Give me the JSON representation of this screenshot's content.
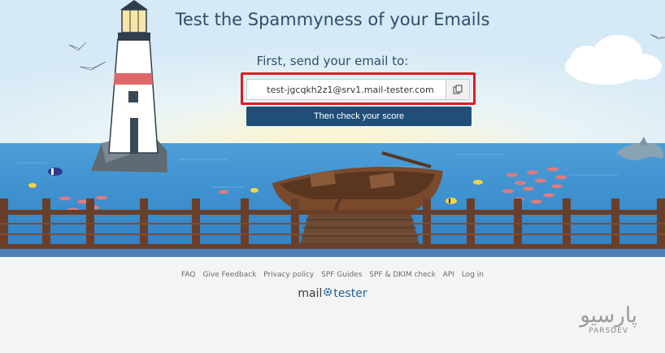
{
  "hero": {
    "title": "Test the Spammyness of your Emails",
    "subtitle": "First, send your email to:",
    "email_address": "test-jgcqkh2z1@srv1.mail-tester.com",
    "check_button": "Then check your score"
  },
  "footer": {
    "links": [
      "FAQ",
      "Give Feedback",
      "Privacy policy",
      "SPF Guides",
      "SPF & DKIM check",
      "API",
      "Log in"
    ],
    "logo_left": "mail",
    "logo_right": "tester"
  },
  "watermark": {
    "persian": "پارسیو",
    "latin": "PARSDEV"
  },
  "colors": {
    "sky": "#d9ecf7",
    "sea": "#3b8fd0",
    "button": "#1f4e78",
    "highlight": "#e01b23",
    "title": "#2e4f6b"
  },
  "icons": {
    "copy": "copy-icon",
    "gear": "gear-icon"
  }
}
